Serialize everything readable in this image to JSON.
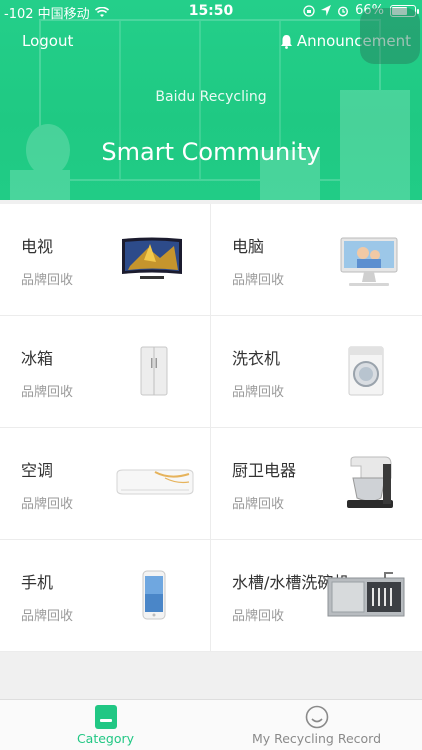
{
  "status_bar": {
    "carrier": "-102 中国移动",
    "time": "15:50",
    "battery": "66%",
    "battery_level": 0.66,
    "icons": [
      "wifi-icon",
      "lock-rotation-icon",
      "location-icon",
      "alarm-icon",
      "battery-icon"
    ]
  },
  "header": {
    "logout_label": "Logout",
    "announcement_label": "Announcement",
    "subtitle": "Baidu Recycling",
    "title": "Smart Community",
    "accent_color": "#21cc86"
  },
  "categories": [
    {
      "name": "电视",
      "sub": "品牌回收",
      "icon": "tv-icon"
    },
    {
      "name": "电脑",
      "sub": "品牌回收",
      "icon": "computer-icon"
    },
    {
      "name": "冰箱",
      "sub": "品牌回收",
      "icon": "fridge-icon"
    },
    {
      "name": "洗衣机",
      "sub": "品牌回收",
      "icon": "washing-machine-icon"
    },
    {
      "name": "空调",
      "sub": "品牌回收",
      "icon": "air-conditioner-icon"
    },
    {
      "name": "厨卫电器",
      "sub": "品牌回收",
      "icon": "stand-mixer-icon"
    },
    {
      "name": "手机",
      "sub": "品牌回收",
      "icon": "phone-icon"
    },
    {
      "name": "水槽/水槽洗碗机",
      "sub": "品牌回收",
      "icon": "sink-dishwasher-icon"
    }
  ],
  "tabs": [
    {
      "label": "Category",
      "icon": "category-icon",
      "active": true
    },
    {
      "label": "My Recycling Record",
      "icon": "record-face-icon",
      "active": false
    }
  ]
}
